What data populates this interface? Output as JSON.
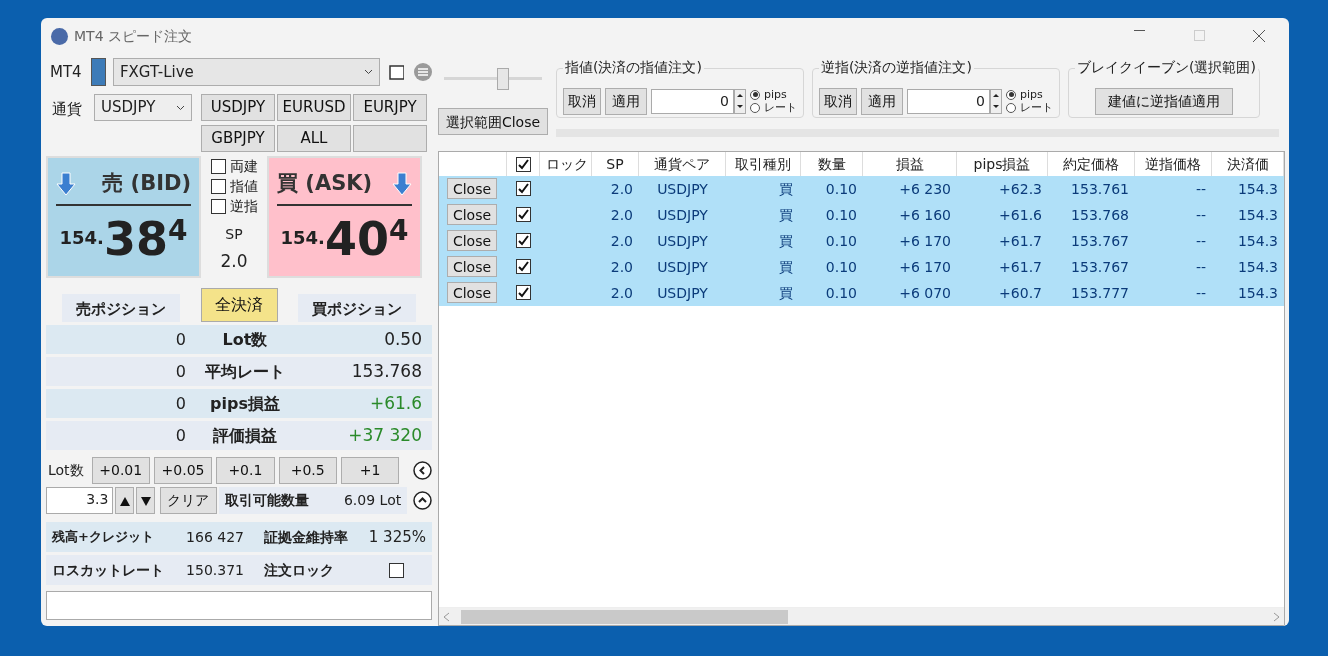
{
  "window": {
    "title": "MT4 スピード注文"
  },
  "account_bar": {
    "platform": "MT4",
    "server": "FXGT-Live"
  },
  "currency": {
    "label": "通貨",
    "value": "USDJPY"
  },
  "symbol_buttons": [
    {
      "kind": "symbol",
      "label": "USDJPY"
    },
    {
      "kind": "symbol",
      "label": "EURUSD"
    },
    {
      "kind": "symbol",
      "label": "EURJPY"
    },
    {
      "kind": "symbol",
      "label": "GBPJPY"
    },
    {
      "kind": "symbol",
      "label": "ALL"
    },
    {
      "kind": "blank"
    }
  ],
  "bid": {
    "label": "売 (BID)",
    "price_head": "154.",
    "price_main": "38",
    "price_tail": "4"
  },
  "ask": {
    "label": "買 (ASK)",
    "price_head": "154.",
    "price_main": "40",
    "price_tail": "4"
  },
  "options": [
    {
      "label": "両建",
      "checked": false
    },
    {
      "label": "指値",
      "checked": false
    },
    {
      "label": "逆指",
      "checked": false
    }
  ],
  "spread": {
    "label": "SP",
    "value": "2.0"
  },
  "positions": {
    "sell_label": "売ポジション",
    "close_all": "全決済",
    "buy_label": "買ポジション"
  },
  "summary": [
    {
      "kind": "plain",
      "sell": "0",
      "label": "Lot数",
      "buy": "0.50"
    },
    {
      "kind": "plain",
      "sell": "0",
      "label": "平均レート",
      "buy": "153.768"
    },
    {
      "kind": "profit",
      "sell": "0",
      "label": "pips損益",
      "buy": "+61.6"
    },
    {
      "kind": "profit",
      "sell": "0",
      "label": "評価損益",
      "buy": "+37 320"
    }
  ],
  "lot": {
    "label": "Lot数",
    "increments": [
      "+0.01",
      "+0.05",
      "+0.1",
      "+0.5",
      "+1"
    ],
    "value": "3.3",
    "clear": "クリア",
    "available_label": "取引可能数量",
    "available": "6.09 Lot"
  },
  "account": {
    "balance_label": "残高+クレジット",
    "balance": "166 427",
    "margin_label": "証拠金維持率",
    "margin": "1 325%",
    "losscut_label": "ロスカットレート",
    "losscut": "150.371",
    "lock_label": "注文ロック",
    "lock_checked": false
  },
  "slider": {
    "level": 0.6
  },
  "close_selected": "選択範囲Close",
  "order_groups": [
    {
      "kind": "order",
      "title": "指値(決済の指値注文)",
      "cancel": "取消",
      "apply": "適用",
      "value": "0",
      "units": [
        {
          "label": "pips",
          "selected": true
        },
        {
          "label": "レート",
          "selected": false
        }
      ]
    },
    {
      "kind": "order",
      "title": "逆指(決済の逆指値注文)",
      "cancel": "取消",
      "apply": "適用",
      "value": "0",
      "units": [
        {
          "label": "pips",
          "selected": true
        },
        {
          "label": "レート",
          "selected": false
        }
      ]
    },
    {
      "kind": "breakeven",
      "title": "ブレイクイーブン(選択範囲)",
      "button": "建値に逆指値適用"
    }
  ],
  "table": {
    "header_checked": true,
    "columns": [
      "ロック",
      "SP",
      "通貨ペア",
      "取引種別",
      "数量",
      "損益",
      "pips損益",
      "約定価格",
      "逆指価格",
      "決済価"
    ],
    "rows": [
      {
        "selected": true,
        "close": "Close",
        "checked": true,
        "cells": [
          "",
          "2.0",
          "USDJPY",
          "買",
          "0.10",
          "+6 230",
          "+62.3",
          "153.761",
          "--",
          "154.3"
        ]
      },
      {
        "selected": true,
        "close": "Close",
        "checked": true,
        "cells": [
          "",
          "2.0",
          "USDJPY",
          "買",
          "0.10",
          "+6 160",
          "+61.6",
          "153.768",
          "--",
          "154.3"
        ]
      },
      {
        "selected": true,
        "close": "Close",
        "checked": true,
        "cells": [
          "",
          "2.0",
          "USDJPY",
          "買",
          "0.10",
          "+6 170",
          "+61.7",
          "153.767",
          "--",
          "154.3"
        ]
      },
      {
        "selected": true,
        "close": "Close",
        "checked": true,
        "cells": [
          "",
          "2.0",
          "USDJPY",
          "買",
          "0.10",
          "+6 170",
          "+61.7",
          "153.767",
          "--",
          "154.3"
        ]
      },
      {
        "selected": true,
        "close": "Close",
        "checked": true,
        "cells": [
          "",
          "2.0",
          "USDJPY",
          "買",
          "0.10",
          "+6 070",
          "+60.7",
          "153.777",
          "--",
          "154.3"
        ]
      }
    ]
  }
}
